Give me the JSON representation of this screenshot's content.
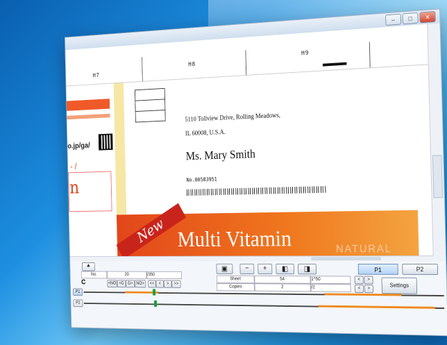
{
  "window": {
    "controls": {
      "minimize": "–",
      "maximize": "□",
      "close": "✕"
    }
  },
  "ruler": {
    "labels": [
      "H7",
      "H8",
      "H9"
    ]
  },
  "document": {
    "left_url": "o.jp/ga/",
    "left_slash": "- /",
    "left_big": "n",
    "address_line1": "5110 Tollview Drive, Rolling Meadows,",
    "address_line2": "IL 60008, U.S.A.",
    "recipient": "Ms. Mary Smith",
    "number": "No.00583951",
    "banner_ribbon": "New",
    "banner_title": "Multi Vitamin",
    "banner_brand": "NATURAL"
  },
  "controls": {
    "repeat_icon": "C",
    "no_label": "No.",
    "current": "20",
    "total": "/350",
    "nav_prev_buttons": [
      "<NO",
      "<G",
      "G>",
      "NO>"
    ],
    "nav_page_buttons": [
      "<<",
      "<",
      ">",
      ">>"
    ],
    "tracks": [
      "P1",
      "P2"
    ],
    "zoom_buttons": [
      "−",
      "+"
    ],
    "sheet_label": "Sheet",
    "sheet_value": "54",
    "sheet_extra": "1^50",
    "copies_label": "Copies",
    "copies_value": "2",
    "copies_extra": "/2",
    "page_tabs": [
      "P1",
      "P2"
    ],
    "settings": "Settings"
  }
}
